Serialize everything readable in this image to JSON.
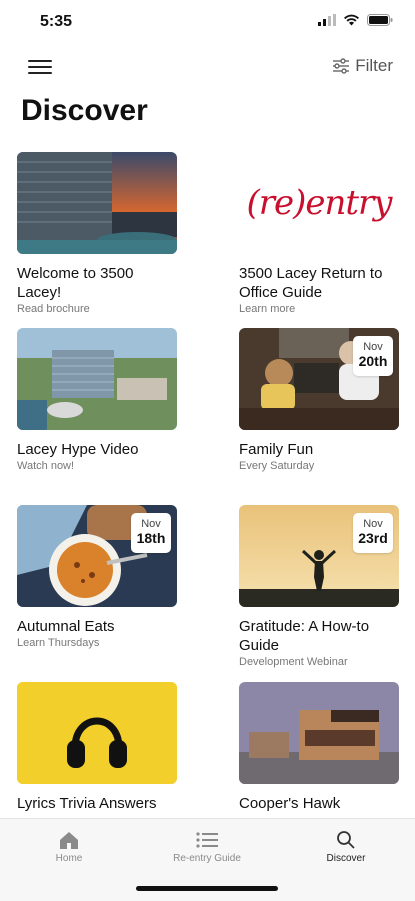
{
  "status_bar": {
    "time": "5:35"
  },
  "header": {
    "filter_label": "Filter",
    "title": "Discover"
  },
  "cards": [
    {
      "title": "Welcome to 3500 Lacey!",
      "subtitle": "Read brochure"
    },
    {
      "title": "3500 Lacey Return to Office Guide",
      "subtitle": "Learn more",
      "logo_text": "(re)entry"
    },
    {
      "title": "Lacey Hype Video",
      "subtitle": "Watch now!"
    },
    {
      "title": "Family Fun",
      "subtitle": "Every Saturday",
      "badge_month": "Nov",
      "badge_day": "20th"
    },
    {
      "title": "Autumnal Eats",
      "subtitle": "Learn Thursdays",
      "badge_month": "Nov",
      "badge_day": "18th"
    },
    {
      "title": "Gratitude: A How-to Guide",
      "subtitle": "Development Webinar",
      "badge_month": "Nov",
      "badge_day": "23rd"
    },
    {
      "title": "Lyrics Trivia Answers",
      "subtitle": ""
    },
    {
      "title": "Cooper's Hawk",
      "subtitle": ""
    }
  ],
  "tabbar": {
    "items": [
      {
        "label": "Home",
        "icon": "home-icon"
      },
      {
        "label": "Re-entry Guide",
        "icon": "list-icon"
      },
      {
        "label": "Discover",
        "icon": "search-icon",
        "active": true
      }
    ]
  },
  "colors": {
    "brand_red": "#c8102e",
    "active_tab": "#222222",
    "inactive_tab": "#8a8a8a"
  }
}
